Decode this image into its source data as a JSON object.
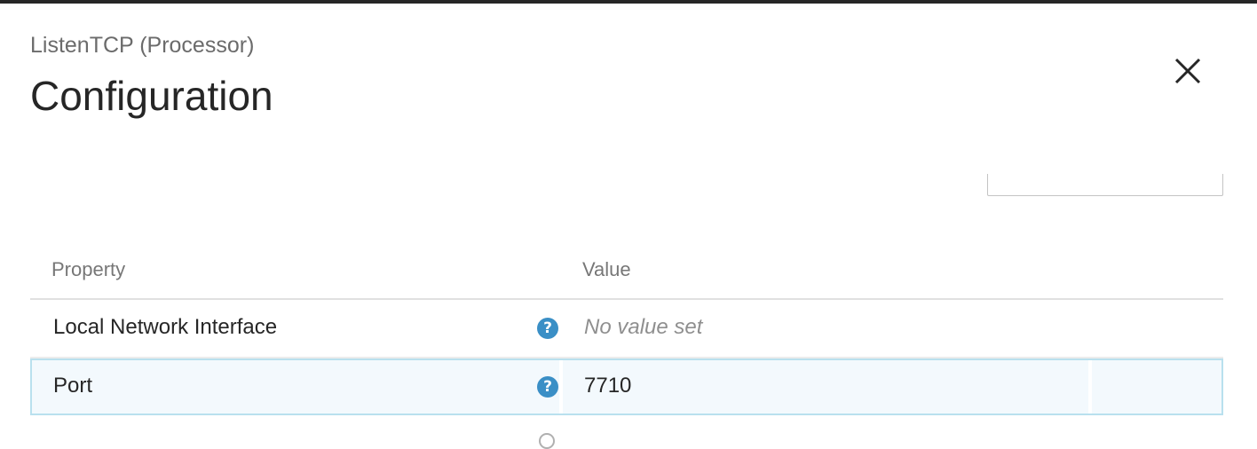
{
  "dialog": {
    "subtitle": "ListenTCP (Processor)",
    "title": "Configuration",
    "close_icon": "close-icon"
  },
  "table": {
    "columns": [
      "Property",
      "Value"
    ],
    "rows": [
      {
        "name": "Local Network Interface",
        "value": "No value set",
        "is_empty": true,
        "help_icon": "help-icon"
      },
      {
        "name": "Port",
        "value": "7710",
        "is_empty": false,
        "help_icon": "help-icon"
      }
    ]
  },
  "colors": {
    "accent": "#3a8fc6",
    "selected_row_bg": "#f3f9fd",
    "selected_row_border": "#b9e0ee"
  }
}
